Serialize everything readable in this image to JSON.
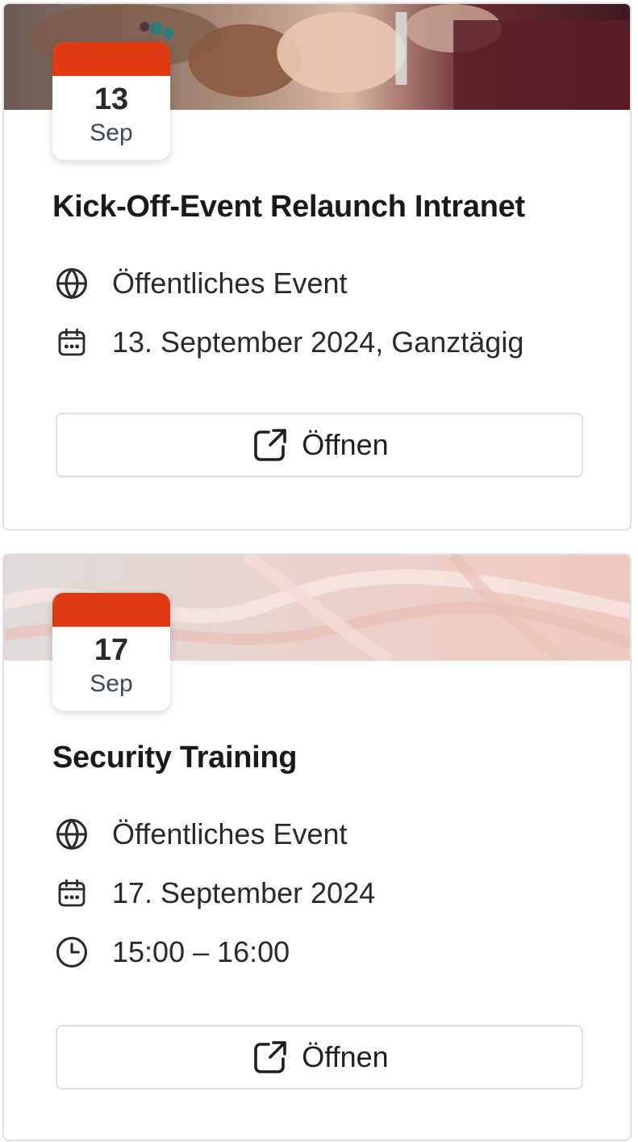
{
  "events": [
    {
      "day": "13",
      "month": "Sep",
      "title": "Kick-Off-Event Relaunch Intranet",
      "visibility": "Öffentliches Event",
      "date": "13. September 2024, Ganztägig",
      "open_label": "Öffnen"
    },
    {
      "day": "17",
      "month": "Sep",
      "title": "Security Training",
      "visibility": "Öffentliches Event",
      "date": "17. September 2024",
      "time": "15:00 – 16:00",
      "open_label": "Öffnen"
    }
  ],
  "colors": {
    "badge_accent": "#e03a12",
    "card_border": "#e2e2e2",
    "text": "#1f1f1f"
  },
  "icons": {
    "visibility": "globe-icon",
    "date": "calendar-icon",
    "time": "clock-icon",
    "open": "external-link-icon"
  }
}
